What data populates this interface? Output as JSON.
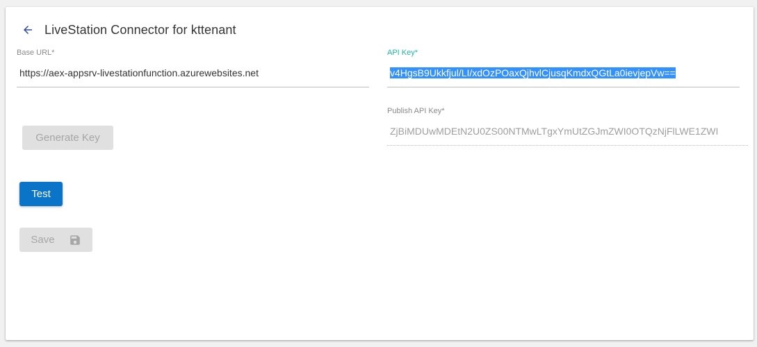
{
  "header": {
    "title": "LiveStation Connector for kttenant"
  },
  "base_url": {
    "label": "Base URL*",
    "value": "https://aex-appsrv-livestationfunction.azurewebsites.net"
  },
  "api_key": {
    "label": "API Key*",
    "value": "v4HgsB9Ukkfjul/LI/xdOzPOaxQjhvlCjusqKmdxQGtLa0ievjepVw=="
  },
  "publish_api_key": {
    "label": "Publish API Key*",
    "value": "ZjBiMDUwMDEtN2U0ZS00NTMwLTgxYmUtZGJmZWI0OTQzNjFlLWE1ZWI"
  },
  "buttons": {
    "generate_key": "Generate Key",
    "test": "Test",
    "save": "Save"
  },
  "colors": {
    "primary": "#0a74c9",
    "focus_label": "#1fb3a6",
    "selection": "#3390ff"
  },
  "icons": {
    "back": "arrow-left-icon",
    "save": "floppy-disk-icon"
  }
}
